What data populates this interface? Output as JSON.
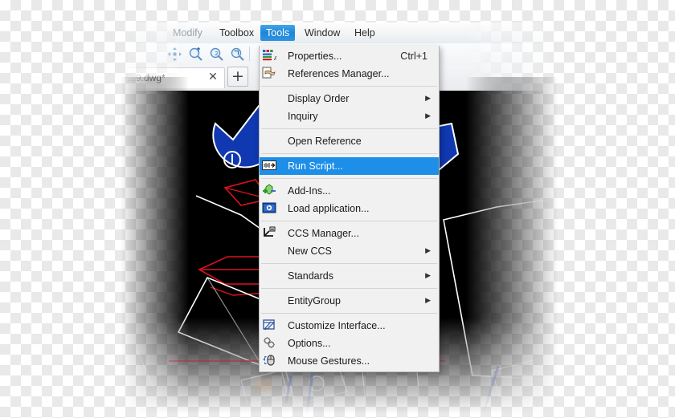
{
  "app": {
    "type": "cad-application",
    "accent_color": "#1d8fe8",
    "menu_bg": "#f1f1f1",
    "canvas_bg": "#000000"
  },
  "menubar": {
    "items": [
      {
        "label": "Modify",
        "state": "dimmed"
      },
      {
        "label": "Toolbox",
        "state": "normal"
      },
      {
        "label": "Tools",
        "state": "active"
      },
      {
        "label": "Window",
        "state": "normal"
      },
      {
        "label": "Help",
        "state": "normal"
      }
    ]
  },
  "toolbar": {
    "icons": [
      {
        "name": "pan-icon",
        "glyph": "pan"
      },
      {
        "name": "zoom-window-icon",
        "glyph": "zoom-window"
      },
      {
        "name": "zoom-previous-icon",
        "glyph": "zoom-previous"
      },
      {
        "name": "zoom-realtime-icon",
        "glyph": "zoom-realtime"
      }
    ]
  },
  "tabbar": {
    "tab_label": "...9.dwg*",
    "close_glyph": "✕",
    "add_glyph": "+"
  },
  "dropdown": {
    "title": "Tools",
    "items": [
      {
        "label": "Properties...",
        "icon": "properties-icon",
        "accel": "Ctrl+1",
        "submenu": false,
        "selected": false,
        "separator_after": false
      },
      {
        "label": "References Manager...",
        "icon": "references-manager-icon",
        "accel": "",
        "submenu": false,
        "selected": false,
        "separator_after": true
      },
      {
        "label": "Display Order",
        "icon": "",
        "accel": "",
        "submenu": true,
        "selected": false,
        "separator_after": false
      },
      {
        "label": "Inquiry",
        "icon": "",
        "accel": "",
        "submenu": true,
        "selected": false,
        "separator_after": true
      },
      {
        "label": "Open Reference",
        "icon": "",
        "accel": "",
        "submenu": false,
        "selected": false,
        "separator_after": true
      },
      {
        "label": "Run Script...",
        "icon": "run-script-icon",
        "accel": "",
        "submenu": false,
        "selected": true,
        "separator_after": true
      },
      {
        "label": "Add-Ins...",
        "icon": "add-ins-icon",
        "accel": "",
        "submenu": false,
        "selected": false,
        "separator_after": false
      },
      {
        "label": "Load application...",
        "icon": "load-application-icon",
        "accel": "",
        "submenu": false,
        "selected": false,
        "separator_after": true
      },
      {
        "label": "CCS Manager...",
        "icon": "ccs-manager-icon",
        "accel": "",
        "submenu": false,
        "selected": false,
        "separator_after": false
      },
      {
        "label": "New CCS",
        "icon": "",
        "accel": "",
        "submenu": true,
        "selected": false,
        "separator_after": true
      },
      {
        "label": "Standards",
        "icon": "",
        "accel": "",
        "submenu": true,
        "selected": false,
        "separator_after": true
      },
      {
        "label": "EntityGroup",
        "icon": "",
        "accel": "",
        "submenu": true,
        "selected": false,
        "separator_after": true
      },
      {
        "label": "Customize Interface...",
        "icon": "customize-interface-icon",
        "accel": "",
        "submenu": false,
        "selected": false,
        "separator_after": false
      },
      {
        "label": "Options...",
        "icon": "options-icon",
        "accel": "",
        "submenu": false,
        "selected": false,
        "separator_after": false
      },
      {
        "label": "Mouse Gestures...",
        "icon": "mouse-gestures-icon",
        "accel": "",
        "submenu": false,
        "selected": false,
        "separator_after": false
      }
    ],
    "submenu_glyph": "▶"
  },
  "canvas": {
    "description": "CAD drawing viewport, black background with white, blue and red vector geometry",
    "entity_colors": {
      "outline": "#ffffff",
      "fill": "#1038b0",
      "highlight": "#e01020"
    }
  }
}
